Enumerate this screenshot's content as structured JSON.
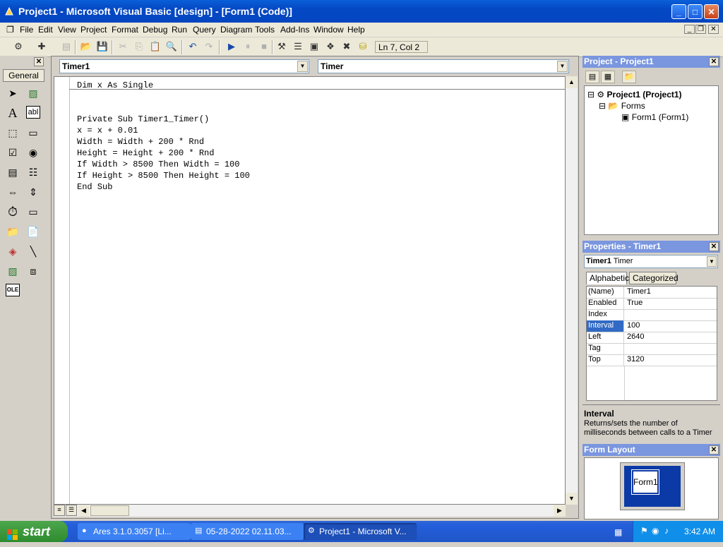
{
  "window": {
    "title": "Project1 - Microsoft Visual Basic [design] - [Form1 (Code)]",
    "minimize": "_",
    "maximize": "□",
    "close": "✕"
  },
  "menu": {
    "items": [
      "File",
      "Edit",
      "View",
      "Project",
      "Format",
      "Debug",
      "Run",
      "Query",
      "Diagram",
      "Tools",
      "Add-Ins",
      "Window",
      "Help"
    ],
    "mdi_minimize": "_",
    "mdi_restore": "❐",
    "mdi_close": "✕"
  },
  "toolbar": {
    "position": "Ln 7, Col 2"
  },
  "toolbox": {
    "tab": "General",
    "close": "✕",
    "text_tool": "A",
    "textbox_tool": "abl",
    "ole_tool": "OLE"
  },
  "code_window": {
    "object_combo": "Timer1",
    "proc_combo": "Timer",
    "declaration": "Dim x As Single",
    "lines": [
      "Private Sub Timer1_Timer()",
      "x = x + 0.01",
      "",
      "Width = Width + 200 * Rnd",
      "Height = Height + 200 * Rnd",
      "",
      "If Width > 8500 Then Width = 100",
      "",
      "If Height > 8500 Then Height = 100",
      "",
      "",
      "",
      "End Sub"
    ]
  },
  "project_panel": {
    "title": "Project - Project1",
    "close": "✕",
    "tree": {
      "root": "Project1 (Project1)",
      "folder": "Forms",
      "item": "Form1 (Form1)"
    }
  },
  "properties_panel": {
    "title": "Properties - Timer1",
    "close": "✕",
    "object_name": "Timer1",
    "object_type": "Timer",
    "tabs": [
      "Alphabetic",
      "Categorized"
    ],
    "rows": [
      {
        "name": "(Name)",
        "value": "Timer1"
      },
      {
        "name": "Enabled",
        "value": "True"
      },
      {
        "name": "Index",
        "value": ""
      },
      {
        "name": "Interval",
        "value": "100"
      },
      {
        "name": "Left",
        "value": "2640"
      },
      {
        "name": "Tag",
        "value": ""
      },
      {
        "name": "Top",
        "value": "3120"
      }
    ],
    "selected_row": "Interval",
    "desc_title": "Interval",
    "desc_text": "Returns/sets the number of milliseconds between calls to a Timer"
  },
  "form_layout": {
    "title": "Form Layout",
    "close": "✕",
    "form_label": "Form1"
  },
  "taskbar": {
    "start": "start",
    "tasks": [
      {
        "label": "Ares 3.1.0.3057   [Li...",
        "active": false
      },
      {
        "label": "05-28-2022 02.11.03...",
        "active": false
      },
      {
        "label": "Project1 - Microsoft V...",
        "active": true
      }
    ],
    "clock": "3:42 AM"
  }
}
